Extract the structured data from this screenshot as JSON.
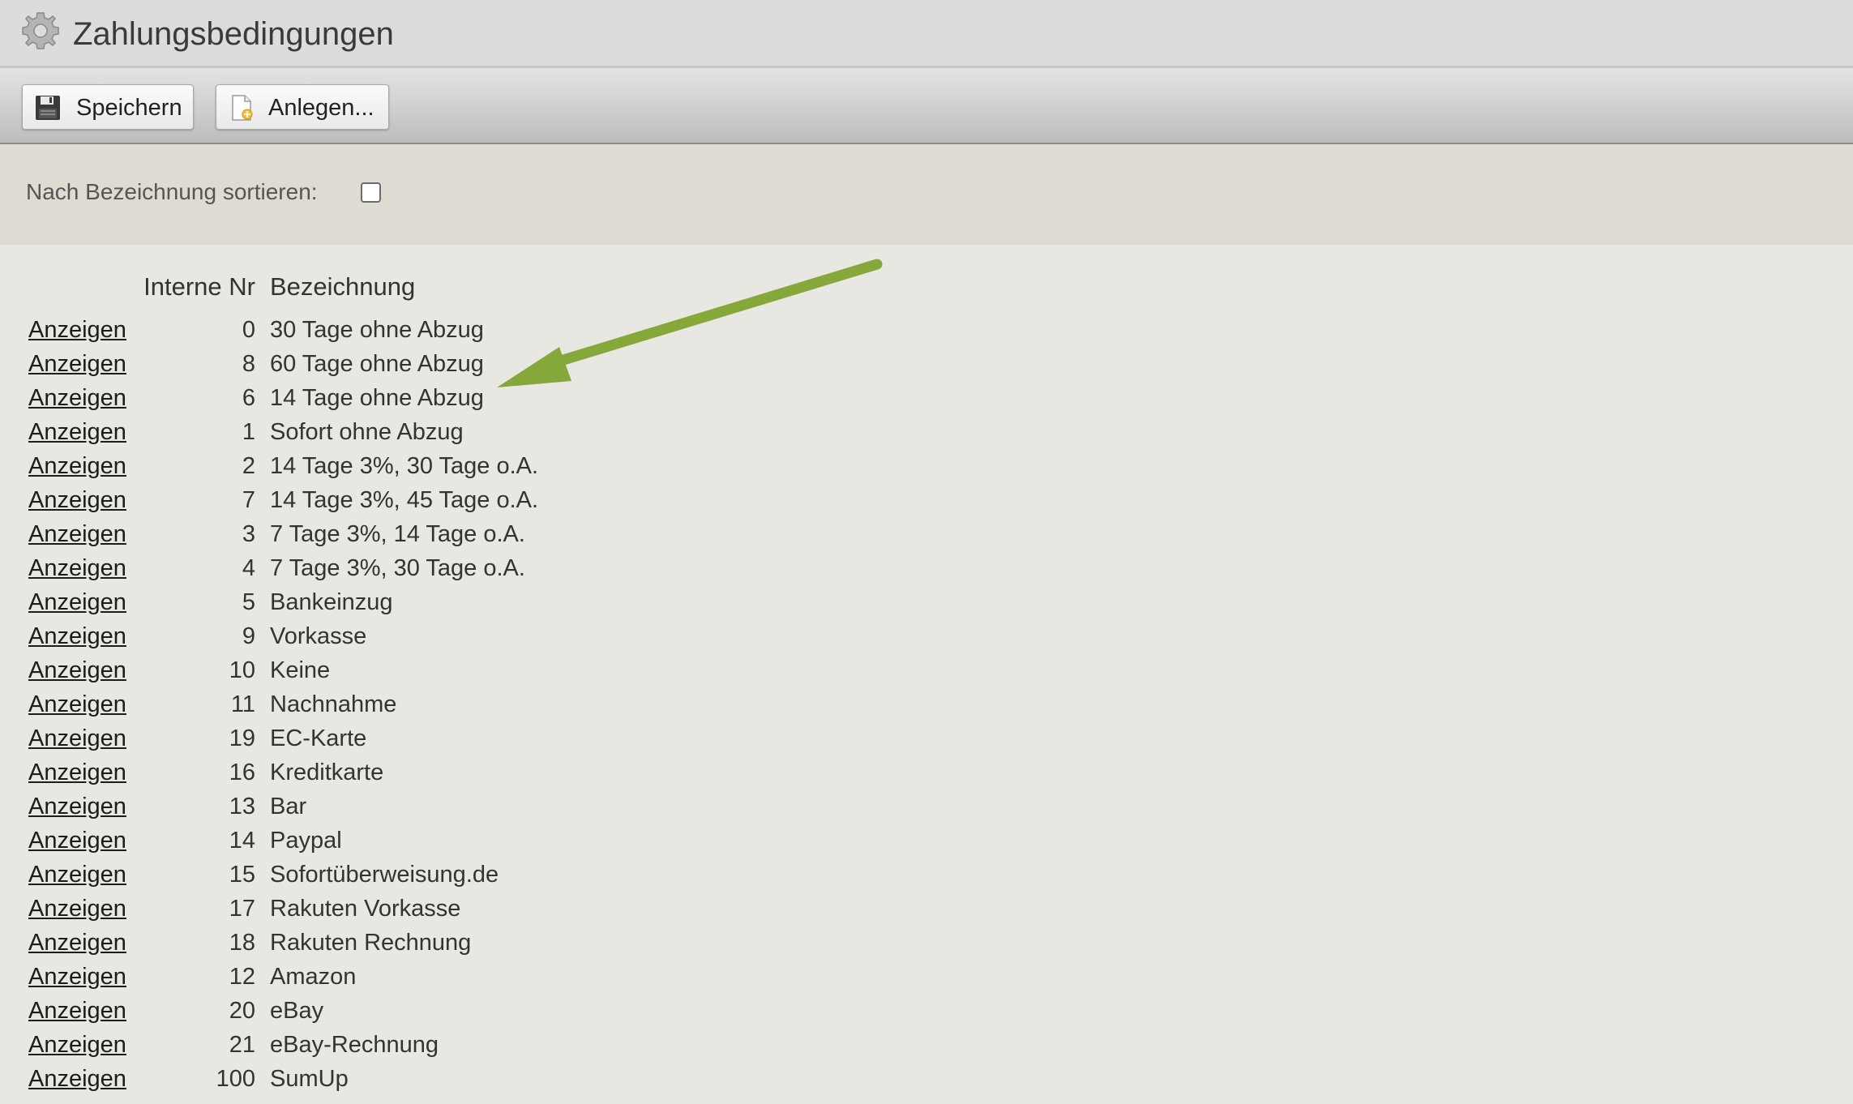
{
  "window": {
    "title": "Zahlungsbedingungen",
    "title_icon": "gear-icon"
  },
  "toolbar": {
    "save_label": "Speichern",
    "save_icon": "floppy-disk-icon",
    "new_label": "Anlegen...",
    "new_icon": "new-document-icon"
  },
  "filter": {
    "sort_label": "Nach Bezeichnung sortieren:",
    "sort_checked": false
  },
  "table": {
    "headers": {
      "nr": "Interne Nr",
      "bezeichnung": "Bezeichnung"
    },
    "rows": [
      {
        "action": "Anzeigen",
        "nr": "0",
        "bezeichnung": "30 Tage ohne Abzug"
      },
      {
        "action": "Anzeigen",
        "nr": "8",
        "bezeichnung": "60 Tage ohne Abzug"
      },
      {
        "action": "Anzeigen",
        "nr": "6",
        "bezeichnung": "14 Tage ohne Abzug"
      },
      {
        "action": "Anzeigen",
        "nr": "1",
        "bezeichnung": "Sofort ohne Abzug"
      },
      {
        "action": "Anzeigen",
        "nr": "2",
        "bezeichnung": "14 Tage 3%, 30 Tage o.A."
      },
      {
        "action": "Anzeigen",
        "nr": "7",
        "bezeichnung": "14 Tage 3%, 45 Tage o.A."
      },
      {
        "action": "Anzeigen",
        "nr": "3",
        "bezeichnung": "7 Tage 3%, 14 Tage o.A."
      },
      {
        "action": "Anzeigen",
        "nr": "4",
        "bezeichnung": "7 Tage 3%, 30 Tage o.A."
      },
      {
        "action": "Anzeigen",
        "nr": "5",
        "bezeichnung": "Bankeinzug"
      },
      {
        "action": "Anzeigen",
        "nr": "9",
        "bezeichnung": "Vorkasse"
      },
      {
        "action": "Anzeigen",
        "nr": "10",
        "bezeichnung": "Keine"
      },
      {
        "action": "Anzeigen",
        "nr": "11",
        "bezeichnung": "Nachnahme"
      },
      {
        "action": "Anzeigen",
        "nr": "19",
        "bezeichnung": "EC-Karte"
      },
      {
        "action": "Anzeigen",
        "nr": "16",
        "bezeichnung": "Kreditkarte"
      },
      {
        "action": "Anzeigen",
        "nr": "13",
        "bezeichnung": "Bar"
      },
      {
        "action": "Anzeigen",
        "nr": "14",
        "bezeichnung": "Paypal"
      },
      {
        "action": "Anzeigen",
        "nr": "15",
        "bezeichnung": "Sofortüberweisung.de"
      },
      {
        "action": "Anzeigen",
        "nr": "17",
        "bezeichnung": "Rakuten Vorkasse"
      },
      {
        "action": "Anzeigen",
        "nr": "18",
        "bezeichnung": "Rakuten Rechnung"
      },
      {
        "action": "Anzeigen",
        "nr": "12",
        "bezeichnung": "Amazon"
      },
      {
        "action": "Anzeigen",
        "nr": "20",
        "bezeichnung": "eBay"
      },
      {
        "action": "Anzeigen",
        "nr": "21",
        "bezeichnung": "eBay-Rechnung"
      },
      {
        "action": "Anzeigen",
        "nr": "100",
        "bezeichnung": "SumUp"
      }
    ]
  },
  "annotation": {
    "arrow_icon": "green-arrow-icon",
    "color": "#86a83a"
  }
}
